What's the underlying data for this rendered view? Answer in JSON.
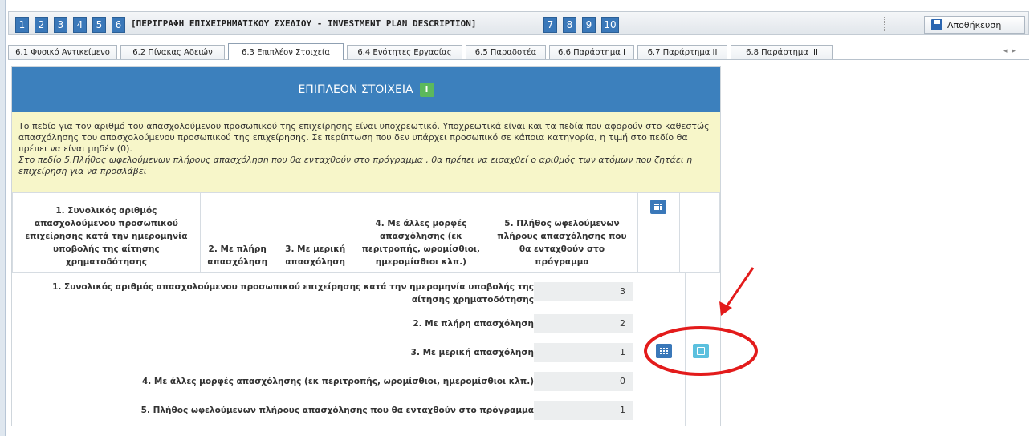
{
  "step_bar": {
    "steps_left": [
      "1",
      "2",
      "3",
      "4",
      "5",
      "6"
    ],
    "title": "[ΠΕΡΙΓΡΑΦΗ ΕΠΙΧΕΙΡΗΜΑΤΙΚΟΥ ΣΧΕΔΙΟΥ - INVESTMENT PLAN DESCRIPTION]",
    "steps_right": [
      "7",
      "8",
      "9",
      "10"
    ],
    "save_label": "Αποθήκευση"
  },
  "tabs": [
    {
      "label": "6.1 Φυσικό Αντικείμενο",
      "active": false
    },
    {
      "label": "6.2 Πίνακας Αδειών",
      "active": false
    },
    {
      "label": "6.3 Επιπλέον Στοιχεία",
      "active": true
    },
    {
      "label": "6.4 Ενότητες Εργασίας",
      "active": false
    },
    {
      "label": "6.5 Παραδοτέα",
      "active": false
    },
    {
      "label": "6.6 Παράρτημα Ι",
      "active": false
    },
    {
      "label": "6.7 Παράρτημα ΙΙ",
      "active": false
    },
    {
      "label": "6.8 Παράρτημα ΙΙΙ",
      "active": false
    }
  ],
  "panel": {
    "title": "ΕΠΙΠΛΕΟΝ ΣΤΟΙΧΕΙΑ",
    "notice_line1": "Το πεδίο για τον αριθμό του απασχολούμενου προσωπικού της επιχείρησης είναι υποχρεωτικό. Υποχρεωτικά είναι και τα πεδία που αφορούν στο καθεστώς απασχόλησης του απασχολούμενου προσωπικού της επιχείρησης. Σε περίπτωση που δεν υπάρχει προσωπικό σε κάποια κατηγορία, η τιμή στο πεδίο θα πρέπει να είναι μηδέν (0).",
    "notice_line2": "Στο πεδίο 5.Πλήθος ωφελούμενων πλήρους απασχόληση που θα ενταχθούν στο πρόγραμμα",
    "notice_line3": " , θα πρέπει να εισαχθεί ο αριθμός των ατόμων που ζητάει η επιχείρηση για να προσλάβει"
  },
  "columns": [
    "1. Συνολικός αριθμός απασχολούμενου προσωπικού επιχείρησης κατά την ημερομηνία υποβολής της αίτησης χρηματοδότησης",
    "2. Με πλήρη απασχόληση",
    "3. Με μερική απασχόληση",
    "4. Με άλλες μορφές απασχόλησης (εκ περιτροπής, ωρομίσθιοι, ημερομίσθιοι κλπ.)",
    "5. Πλήθος ωφελούμενων πλήρους απασχόλησης που θα ενταχθούν στο πρόγραμμα"
  ],
  "rows": [
    {
      "label": "1. Συνολικός αριθμός απασχολούμενου προσωπικού επιχείρησης κατά την ημερομηνία υποβολής της αίτησης χρηματοδότησης",
      "value": "3"
    },
    {
      "label": "2. Με πλήρη απασχόληση",
      "value": "2"
    },
    {
      "label": "3. Με μερική απασχόληση",
      "value": "1"
    },
    {
      "label": "4. Με άλλες μορφές απασχόλησης (εκ περιτροπής, ωρομίσθιοι, ημερομίσθιοι κλπ.)",
      "value": "0"
    },
    {
      "label": "5. Πλήθος ωφελούμενων πλήρους απασχόλησης που θα ενταχθούν στο πρόγραμμα",
      "value": "1"
    }
  ],
  "colors": {
    "header_blue": "#3c80bd",
    "notice_yellow": "#f7f6c9",
    "annotation_red": "#e31b1b"
  }
}
